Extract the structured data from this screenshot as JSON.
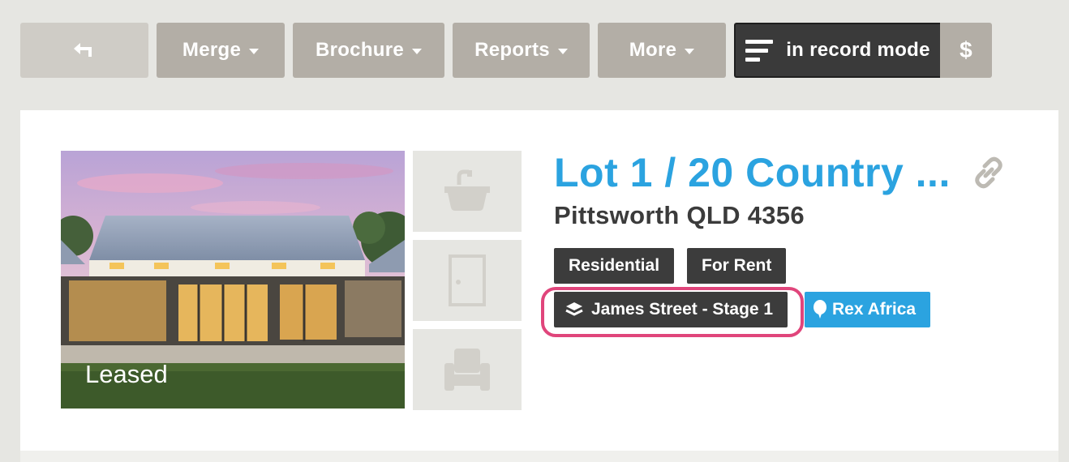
{
  "toolbar": {
    "back_icon": "back-arrow-icon",
    "merge_label": "Merge",
    "brochure_label": "Brochure",
    "reports_label": "Reports",
    "more_label": "More",
    "record_mode_label": "in record mode",
    "dollar_label": "$"
  },
  "listing": {
    "photo_status": "Leased",
    "title": "Lot 1 / 20 Country ...",
    "subtitle": "Pittsworth QLD 4356",
    "tags": [
      "Residential",
      "For Rent"
    ],
    "project_tag": "James Street - Stage 1",
    "agency_tag": "Rex Africa",
    "thumbnails": [
      "sink-icon",
      "door-icon",
      "armchair-icon"
    ]
  },
  "colors": {
    "accent": "#2ba3e0",
    "highlight": "#e0457b",
    "toolbar_button": "#b3aea6",
    "tag_dark": "#3c3c3c"
  }
}
